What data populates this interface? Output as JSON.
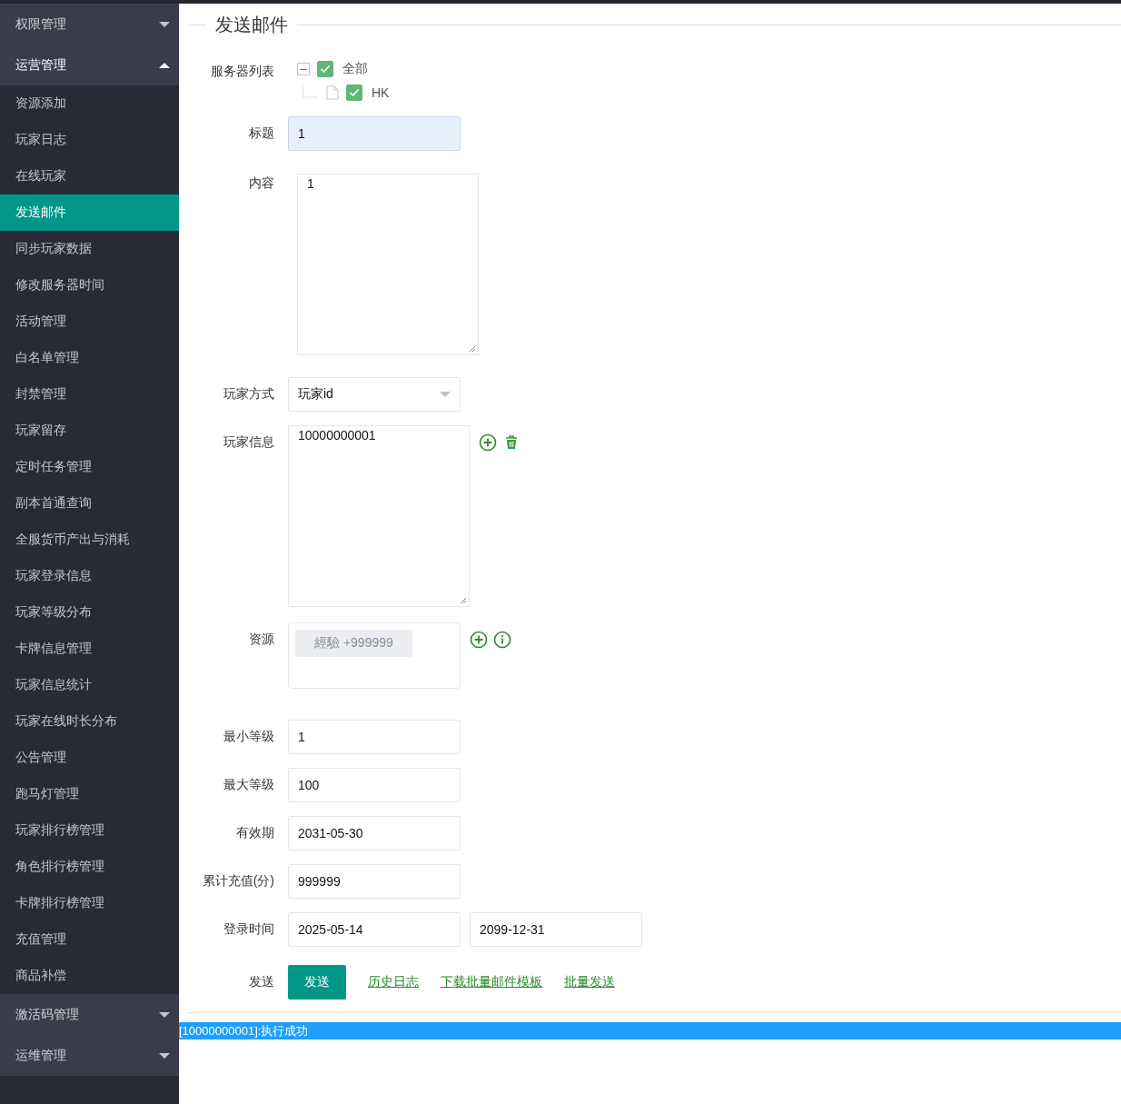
{
  "sidebar": {
    "groups": [
      {
        "label": "权限管理",
        "expanded": false
      },
      {
        "label": "运营管理",
        "expanded": true,
        "children": [
          {
            "label": "资源添加",
            "selected": false
          },
          {
            "label": "玩家日志",
            "selected": false
          },
          {
            "label": "在线玩家",
            "selected": false
          },
          {
            "label": "发送邮件",
            "selected": true
          },
          {
            "label": "同步玩家数据",
            "selected": false
          },
          {
            "label": "修改服务器时间",
            "selected": false
          },
          {
            "label": "活动管理",
            "selected": false
          },
          {
            "label": "白名单管理",
            "selected": false
          },
          {
            "label": "封禁管理",
            "selected": false
          },
          {
            "label": "玩家留存",
            "selected": false
          },
          {
            "label": "定时任务管理",
            "selected": false
          },
          {
            "label": "副本首通查询",
            "selected": false
          },
          {
            "label": "全服货币产出与消耗",
            "selected": false
          },
          {
            "label": "玩家登录信息",
            "selected": false
          },
          {
            "label": "玩家等级分布",
            "selected": false
          },
          {
            "label": "卡牌信息管理",
            "selected": false
          },
          {
            "label": "玩家信息统计",
            "selected": false
          },
          {
            "label": "玩家在线时长分布",
            "selected": false
          },
          {
            "label": "公告管理",
            "selected": false
          },
          {
            "label": "跑马灯管理",
            "selected": false
          },
          {
            "label": "玩家排行榜管理",
            "selected": false
          },
          {
            "label": "角色排行榜管理",
            "selected": false
          },
          {
            "label": "卡牌排行榜管理",
            "selected": false
          },
          {
            "label": "充值管理",
            "selected": false
          },
          {
            "label": "商品补偿",
            "selected": false
          }
        ]
      },
      {
        "label": "激活码管理",
        "expanded": false
      },
      {
        "label": "运维管理",
        "expanded": false
      }
    ]
  },
  "form": {
    "title": "发送邮件",
    "rows": [
      {
        "kind": "tree",
        "label": "服务器列表",
        "tree": {
          "label": "全部",
          "checked": true,
          "expanded": true,
          "children": [
            {
              "label": "HK",
              "checked": true
            }
          ]
        }
      },
      {
        "kind": "input",
        "label": "标题",
        "value": "1",
        "autofilled": true
      },
      {
        "kind": "textarea",
        "label": "内容",
        "value": "1"
      },
      {
        "kind": "select",
        "label": "玩家方式",
        "value": "玩家id"
      },
      {
        "kind": "players",
        "label": "玩家信息",
        "value": "10000000001"
      },
      {
        "kind": "tags",
        "label": "资源",
        "tags": [
          "經驗 +999999"
        ]
      },
      {
        "kind": "input",
        "label": "最小等级",
        "value": "1",
        "autofilled": false
      },
      {
        "kind": "input",
        "label": "最大等级",
        "value": "100",
        "autofilled": false
      },
      {
        "kind": "input",
        "label": "有效期",
        "value": "2031-05-30",
        "autofilled": false
      },
      {
        "kind": "input",
        "label": "累计充值(分)",
        "value": "999999",
        "autofilled": false
      },
      {
        "kind": "range",
        "label": "登录时间",
        "values": [
          "2025-05-14",
          "2099-12-31"
        ]
      },
      {
        "kind": "actions",
        "label": "发送",
        "button": "发送",
        "links": [
          "历史日志",
          "下载批量邮件模板",
          "批量发送"
        ]
      }
    ]
  },
  "status_message": "[10000000001]:执行成功"
}
